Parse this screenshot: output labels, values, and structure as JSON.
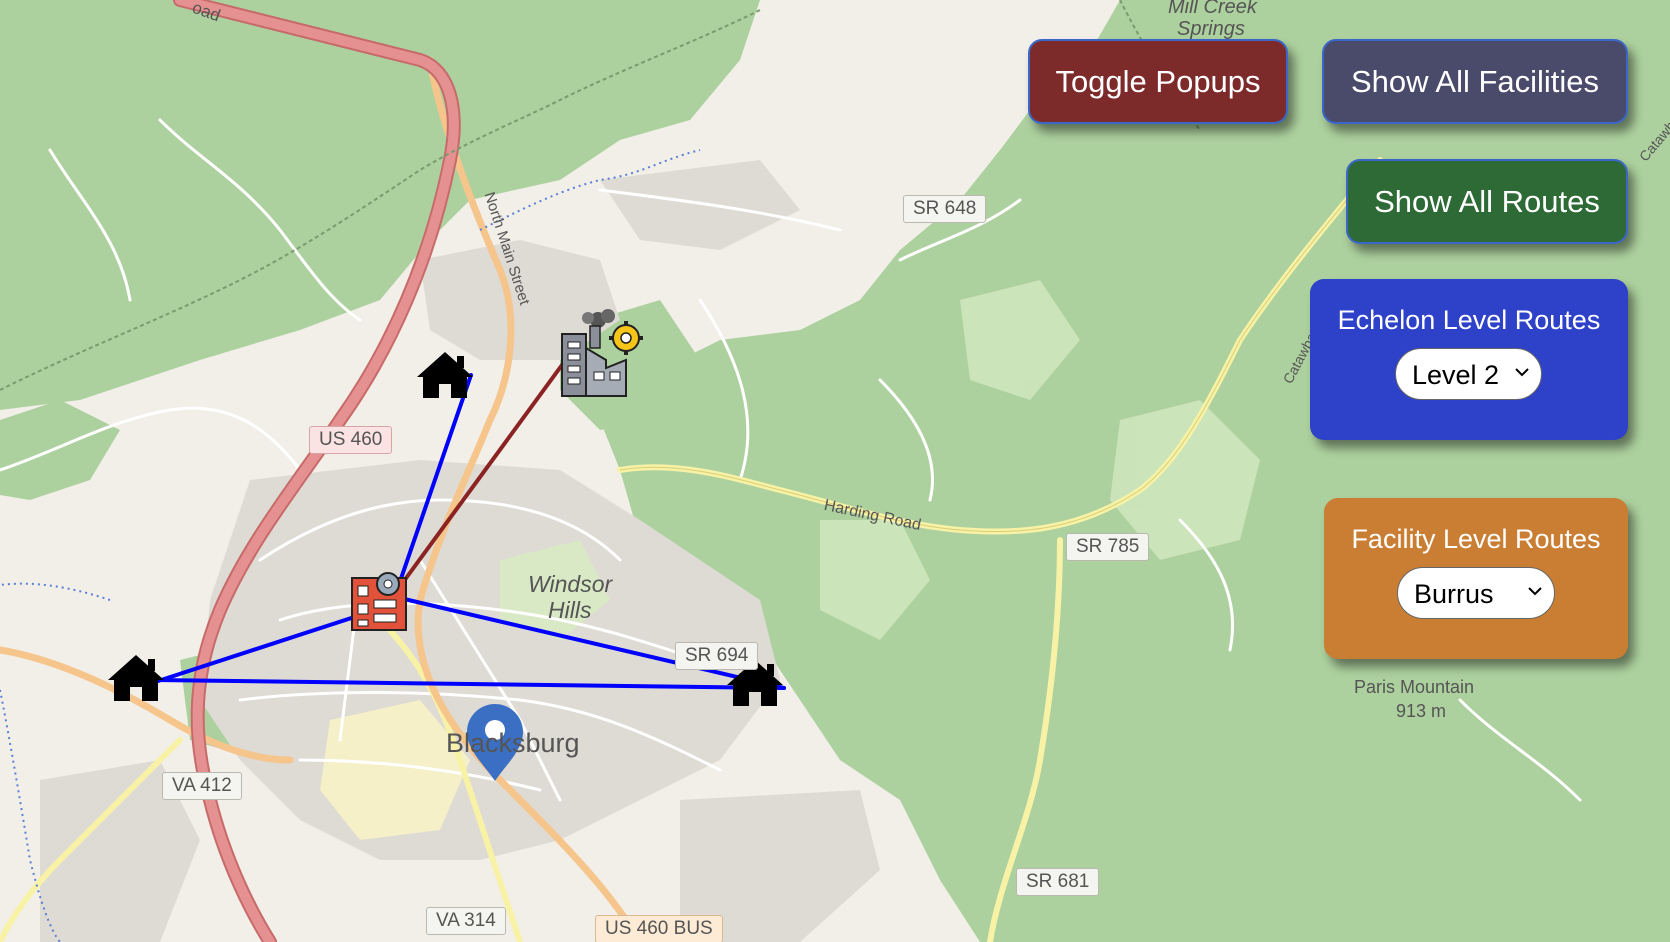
{
  "controls": {
    "toggle_popups": "Toggle Popups",
    "show_all_facilities": "Show All Facilities",
    "show_all_routes": "Show All Routes"
  },
  "echelon_panel": {
    "title": "Echelon Level Routes",
    "selected": "Level 2"
  },
  "facility_panel": {
    "title": "Facility Level Routes",
    "selected": "Burrus"
  },
  "map_labels": {
    "place_town": "Blacksburg",
    "place_windsor_1": "Windsor",
    "place_windsor_2": "Hills",
    "mill_creek_1": "Mill Creek",
    "mill_creek_2": "Springs",
    "paris_mountain": "Paris Mountain",
    "paris_elevation": "913 m",
    "north_main_street": "North Main Street",
    "harding_road": "Harding Road",
    "road_fragment": "oad",
    "catawba_1": "Catawba",
    "catawba_2": "Catawba"
  },
  "road_shields": {
    "us460": "US 460",
    "sr648": "SR 648",
    "sr785": "SR 785",
    "sr694": "SR 694",
    "va412": "VA 412",
    "sr681": "SR 681",
    "va314": "VA 314",
    "us460bus": "US 460 BUS"
  },
  "colors": {
    "toggle_popups_bg": "#7d2a2a",
    "show_all_facilities_bg": "#4a4a6a",
    "show_all_routes_bg": "#2d6a35",
    "echelon_panel_bg": "#2d41c9",
    "facility_panel_bg": "#c97e34",
    "route_blue": "#0000ff",
    "route_maroon": "#8b2323",
    "forest_green": "#add19e",
    "location_pin": "#3b6fc4"
  }
}
